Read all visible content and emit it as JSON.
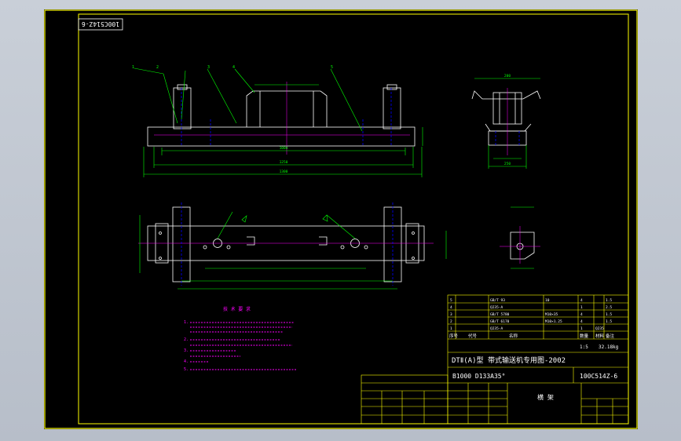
{
  "drawing_id_stamp": "100C514Z-6",
  "colors": {
    "background": "#000000",
    "frame": "#ffff00",
    "outline": "#ffffff",
    "dimension": "#00ff00",
    "centerline": "#ff00ff",
    "hidden": "#0000ff",
    "annotation": "#ff00ff",
    "accent": "#ffff00"
  },
  "part_balloons": [
    "1",
    "2",
    "3",
    "4",
    "5"
  ],
  "dimensions": {
    "top_width": "1000",
    "bottom_width": "1250",
    "overall_length": "1300",
    "side_width": "200",
    "side_base": "250"
  },
  "notes_title": "技 术 要 求",
  "notes_lines": [
    "1.",
    "2.",
    "3.",
    "4.",
    "5."
  ],
  "title_block": {
    "project_line": "DTⅡ(A)型 带式输送机专用图-2002",
    "spec_code": "B1000 D133A35°",
    "drawing_number": "100C514Z-6",
    "drawing_name": "横 架",
    "scale": "1:5",
    "weight": "32.18kg",
    "bom_header": [
      "序号",
      "代号",
      "名称",
      "数量",
      "材料",
      "备注"
    ],
    "bom_rows": [
      [
        "1",
        "Q235-A",
        "",
        "1",
        "Q235",
        ""
      ],
      [
        "2",
        "GB/T 6170",
        "M10×1.25",
        "4",
        "",
        "1.5"
      ],
      [
        "3",
        "GB/T 5780",
        "M10×35",
        "4",
        "",
        "1.5"
      ],
      [
        "4",
        "Q235-A",
        "",
        "1",
        "",
        "2.5"
      ],
      [
        "5",
        "GB/T 93",
        "10",
        "4",
        "",
        "1.5"
      ]
    ]
  }
}
